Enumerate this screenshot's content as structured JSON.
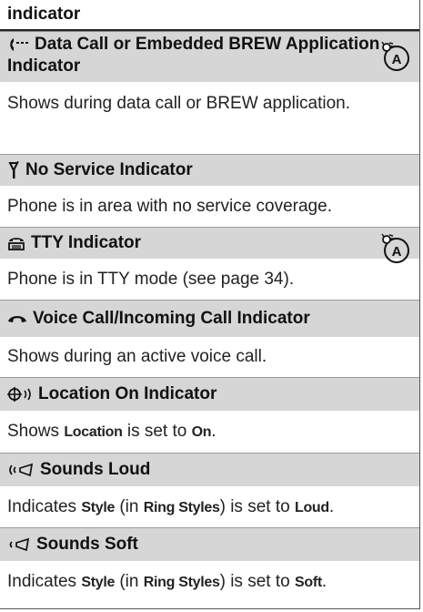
{
  "table": {
    "header": "indicator",
    "rows": [
      {
        "title": "Data Call or Embedded BREW Application Indicator",
        "icon": "data-call-icon",
        "badge": "network-feature-icon",
        "desc": "Shows during data call or BREW application."
      },
      {
        "title": "No Service Indicator",
        "icon": "no-service-icon",
        "desc": "Phone is in area with no service coverage."
      },
      {
        "title": "TTY Indicator",
        "icon": "tty-icon",
        "badge": "network-feature-icon",
        "desc": "Phone is in TTY mode (see page 34)."
      },
      {
        "title": "Voice Call/Incoming Call Indicator",
        "icon": "voice-call-icon",
        "desc": "Shows during an active voice call."
      },
      {
        "title": "Location On Indicator",
        "icon": "location-icon",
        "desc_parts": [
          "Shows ",
          "Location",
          " is set to ",
          "On",
          "."
        ]
      },
      {
        "title": "Sounds Loud",
        "icon": "sounds-loud-icon",
        "desc_parts": [
          "Indicates ",
          "Style",
          " (in ",
          "Ring Styles",
          ") is set to ",
          "Loud",
          "."
        ]
      },
      {
        "title": "Sounds Soft",
        "icon": "sounds-soft-icon",
        "desc_parts": [
          "Indicates ",
          "Style",
          " (in ",
          "Ring Styles",
          ") is set to ",
          "Soft",
          "."
        ]
      }
    ]
  }
}
